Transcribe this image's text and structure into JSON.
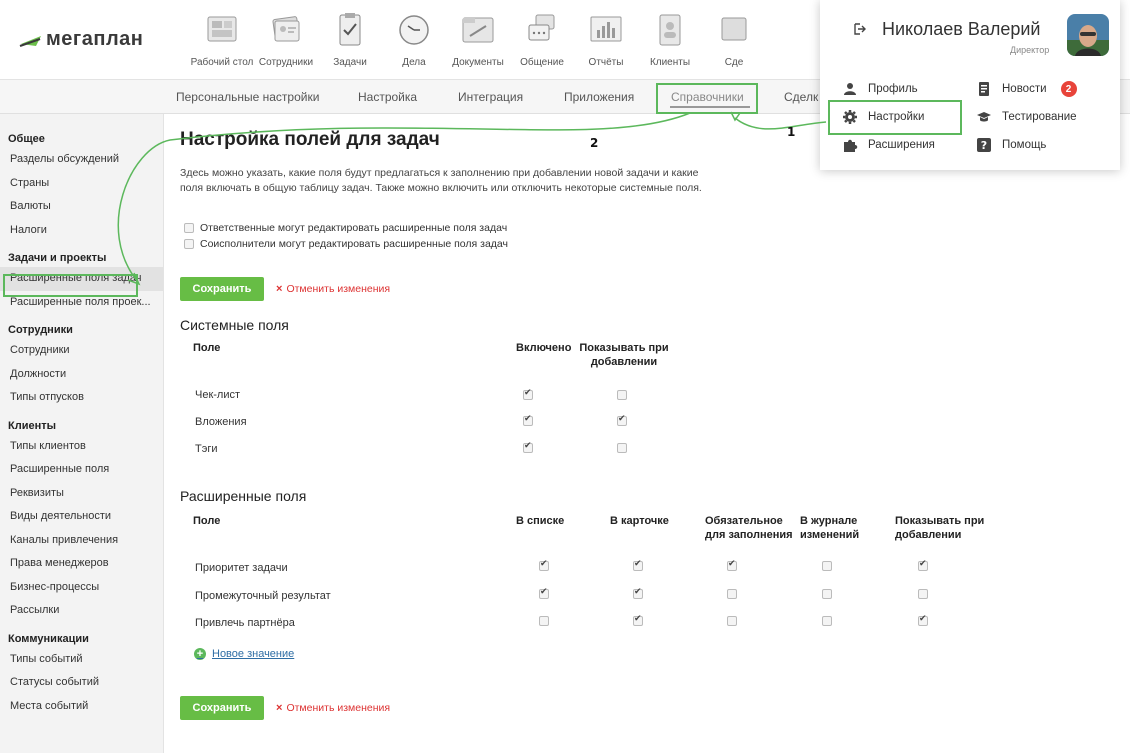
{
  "app": {
    "logo_text": "мегаплан"
  },
  "nav": [
    {
      "label": "Рабочий стол",
      "icon": "desktop-icon"
    },
    {
      "label": "Сотрудники",
      "icon": "employees-icon"
    },
    {
      "label": "Задачи",
      "icon": "tasks-icon"
    },
    {
      "label": "Дела",
      "icon": "clock-icon"
    },
    {
      "label": "Документы",
      "icon": "documents-icon"
    },
    {
      "label": "Общение",
      "icon": "chat-icon"
    },
    {
      "label": "Отчёты",
      "icon": "reports-icon"
    },
    {
      "label": "Клиенты",
      "icon": "clients-icon"
    },
    {
      "label": "Сде",
      "icon": "deals-icon"
    }
  ],
  "subnav": {
    "items": [
      "Персональные настройки",
      "Настройка",
      "Интеграция",
      "Приложения",
      "Справочники",
      "Сделк"
    ],
    "active": "Справочники"
  },
  "sidebar": {
    "groups": [
      {
        "title": "Общее",
        "items": [
          "Разделы обсуждений",
          "Страны",
          "Валюты",
          "Налоги"
        ]
      },
      {
        "title": "Задачи и проекты",
        "items": [
          "Расширенные поля задач",
          "Расширенные поля проек..."
        ]
      },
      {
        "title": "Сотрудники",
        "items": [
          "Сотрудники",
          "Должности",
          "Типы отпусков"
        ]
      },
      {
        "title": "Клиенты",
        "items": [
          "Типы клиентов",
          "Расширенные поля",
          "Реквизиты",
          "Виды деятельности",
          "Каналы привлечения",
          "Права менеджеров",
          "Бизнес-процессы",
          "Рассылки"
        ]
      },
      {
        "title": "Коммуникации",
        "items": [
          "Типы событий",
          "Статусы событий",
          "Места событий"
        ]
      }
    ],
    "active_item": "Расширенные поля задач"
  },
  "main": {
    "title": "Настройка полей для задач",
    "description": "Здесь можно указать, какие поля будут предлагаться к заполнению при добавлении новой задачи и какие поля включать в общую таблицу задач. Также можно включить или отключить некоторые системные поля.",
    "options": [
      {
        "label": "Ответственные могут редактировать расширенные поля задач",
        "checked": false
      },
      {
        "label": "Соисполнители могут редактировать расширенные поля задач",
        "checked": false
      }
    ],
    "save_label": "Сохранить",
    "cancel_label": "Отменить изменения",
    "system_fields": {
      "title": "Системные поля",
      "col_field": "Поле",
      "col_enabled": "Включено",
      "col_show_on_add": "Показывать при добавлении",
      "rows": [
        {
          "name": "Чек-лист",
          "enabled": true,
          "show": false
        },
        {
          "name": "Вложения",
          "enabled": true,
          "show": true
        },
        {
          "name": "Тэги",
          "enabled": true,
          "show": false
        }
      ]
    },
    "extended_fields": {
      "title": "Расширенные поля",
      "col_field": "Поле",
      "cols": [
        "В списке",
        "В карточке",
        "Обязательное для заполнения",
        "В журнале изменений",
        "Показывать при добавлении"
      ],
      "rows": [
        {
          "name": "Приоритет задачи",
          "values": [
            true,
            true,
            true,
            false,
            true
          ]
        },
        {
          "name": "Промежуточный результат",
          "values": [
            true,
            true,
            false,
            false,
            false
          ]
        },
        {
          "name": "Привлечь партнёра",
          "values": [
            false,
            true,
            false,
            false,
            true
          ]
        }
      ],
      "add_label": "Новое значение"
    }
  },
  "dropdown": {
    "user_name": "Николаев Валерий",
    "role": "Директор",
    "items": [
      {
        "label": "Профиль",
        "icon": "user-icon"
      },
      {
        "label": "Новости",
        "icon": "news-icon",
        "badge": "2"
      },
      {
        "label": "Настройки",
        "icon": "gear-icon"
      },
      {
        "label": "Тестирование",
        "icon": "graduation-cap-icon"
      },
      {
        "label": "Расширения",
        "icon": "puzzle-icon"
      },
      {
        "label": "Помощь",
        "icon": "help-icon"
      }
    ]
  },
  "annotations": {
    "step1": "1",
    "step2": "2"
  },
  "colors": {
    "accent_green": "#67bd45",
    "highlight_green": "#5cb85c",
    "cancel_red": "#dd3333",
    "badge_red": "#e8443a",
    "link_blue": "#2e6da4"
  }
}
